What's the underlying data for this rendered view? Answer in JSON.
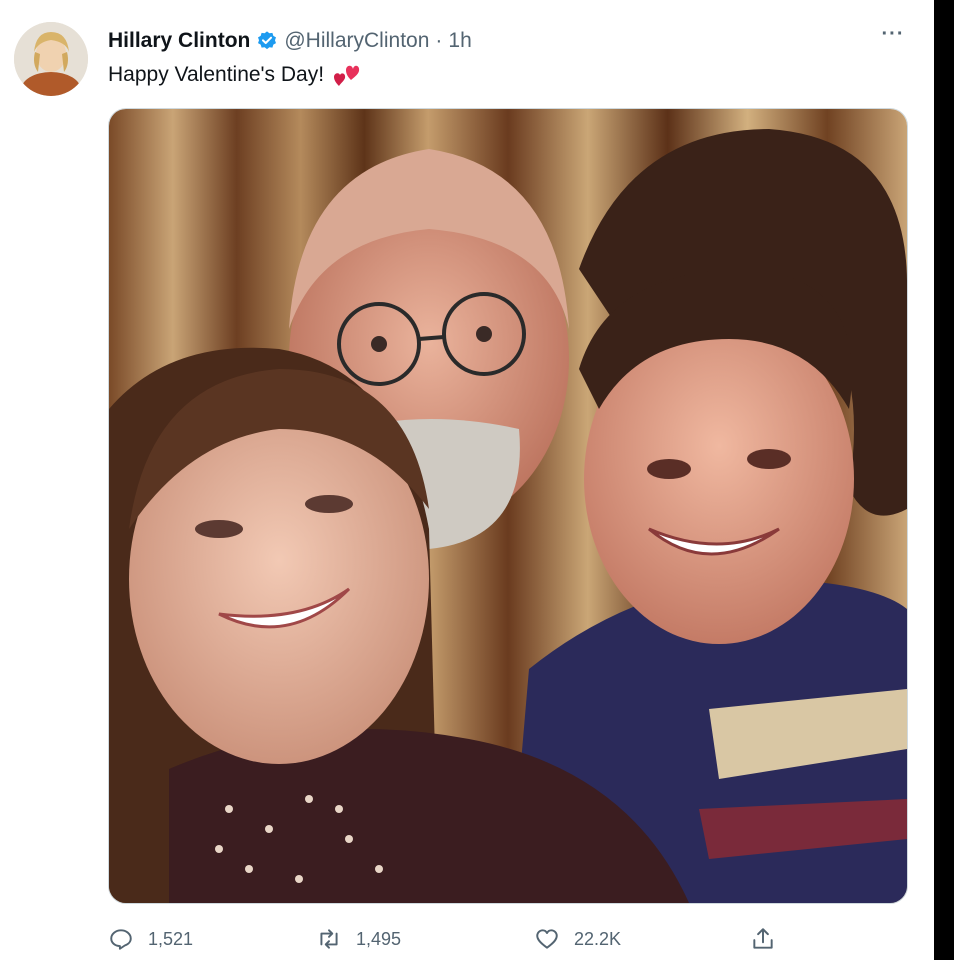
{
  "tweet": {
    "author_name": "Hillary Clinton",
    "handle": "@HillaryClinton",
    "separator": "·",
    "time": "1h",
    "text": "Happy Valentine's Day!",
    "more_label": "···"
  },
  "actions": {
    "replies": "1,521",
    "retweets": "1,495",
    "likes": "22.2K"
  },
  "colors": {
    "verified_blue": "#1d9bf0",
    "text_primary": "#0f1419",
    "text_secondary": "#536471",
    "emoji_red": "#e8315b"
  },
  "icons": [
    "verified-badge-icon",
    "more-options-icon",
    "two-hearts-emoji-icon",
    "reply-icon",
    "retweet-icon",
    "like-icon",
    "share-icon"
  ]
}
